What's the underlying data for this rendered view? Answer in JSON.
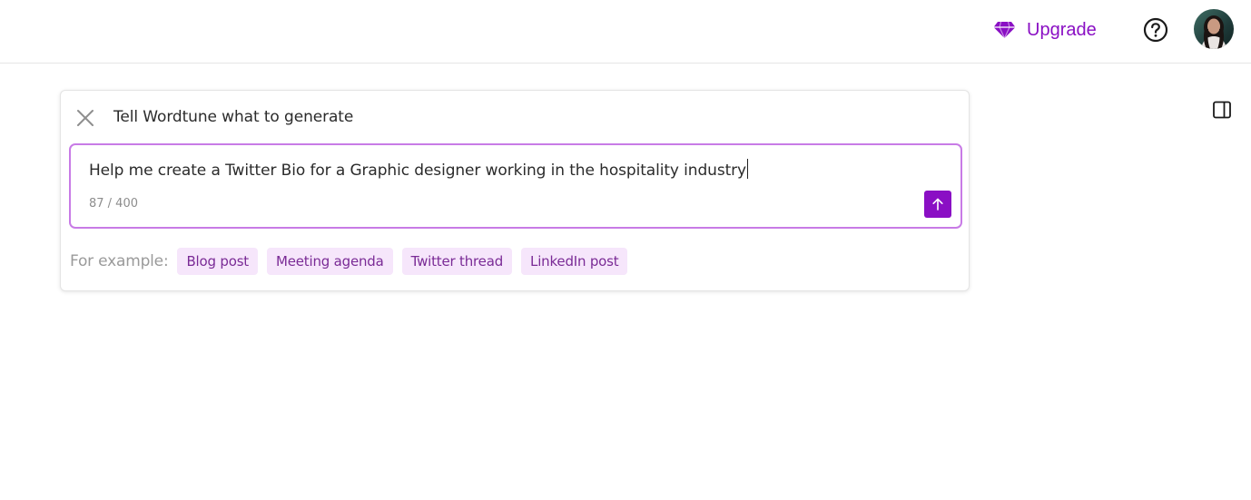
{
  "topbar": {
    "upgrade_label": "Upgrade",
    "accent_color": "#8a0fc4"
  },
  "generator": {
    "title": "Tell Wordtune what to generate",
    "prompt_value": "Help me create a Twitter Bio for a Graphic designer working in the hospitality industry",
    "char_count": "87 / 400",
    "examples_label": "For example:",
    "examples": [
      "Blog post",
      "Meeting agenda",
      "Twitter thread",
      "LinkedIn post"
    ]
  },
  "icons": {
    "upgrade": "diamond-icon",
    "help": "question-circle-icon",
    "close": "close-icon",
    "submit": "arrow-up-icon",
    "panel": "sidebar-panel-icon"
  }
}
